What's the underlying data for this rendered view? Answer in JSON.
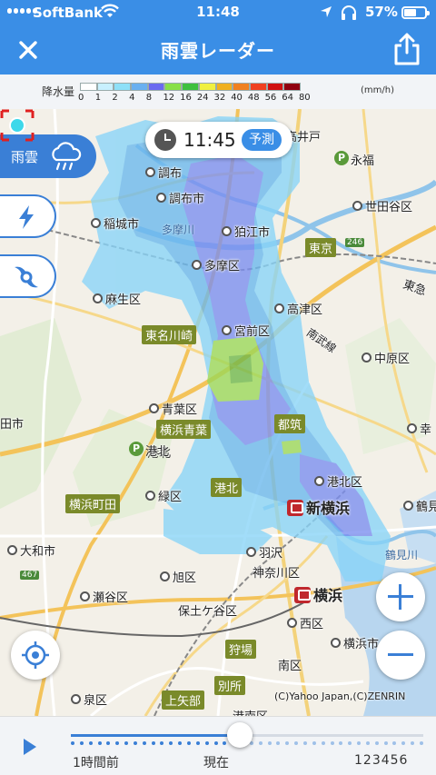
{
  "status_bar": {
    "carrier": "SoftBank",
    "time": "11:48",
    "battery": "57%",
    "battery_level": 0.57
  },
  "header": {
    "title": "雨雲レーダー",
    "close_icon": "close-icon",
    "share_icon": "share-icon"
  },
  "legend": {
    "label": "降水量",
    "unit": "(mm/h)",
    "values": [
      "0",
      "1",
      "2",
      "4",
      "8",
      "12",
      "16",
      "24",
      "32",
      "40",
      "48",
      "56",
      "64",
      "80"
    ],
    "colors": [
      "#ffffff",
      "#c8f0ff",
      "#8ee0f8",
      "#6ab0f0",
      "#6a6af0",
      "#88e048",
      "#3ec03e",
      "#f0f040",
      "#f0b020",
      "#f08020",
      "#f04020",
      "#d01010",
      "#900010"
    ]
  },
  "map": {
    "time_pill": {
      "time": "11:45",
      "badge": "予測"
    },
    "side_buttons": {
      "rain_label": "雨雲",
      "lightning_icon": "lightning-icon",
      "typhoon_icon": "typhoon-icon"
    },
    "places": [
      "調布",
      "調布市",
      "稲城市",
      "多摩川",
      "狛江市",
      "世田谷区",
      "多摩区",
      "麻生区",
      "高津区",
      "宮前区",
      "南武線",
      "中原区",
      "青葉区",
      "都筑",
      "港北",
      "港北区",
      "鶴見",
      "緑区",
      "横浜町田",
      "大和市",
      "羽沢",
      "神奈川区",
      "旭区",
      "瀬谷区",
      "保土ケ谷区",
      "西区",
      "狩場",
      "南区",
      "横浜市",
      "別所",
      "上矢部",
      "港南区",
      "泉区",
      "永福",
      "東京",
      "東急",
      "高井戸",
      "東名川崎",
      "横浜青葉",
      "新横浜",
      "横浜",
      "鶴見川",
      "鶴見",
      "田市",
      "幸",
      "246",
      "467"
    ],
    "copyright": "(C)Yahoo Japan,(C)ZENRIN"
  },
  "timeline": {
    "label_past": "1時間前",
    "label_now": "現在",
    "label_future": "123456",
    "position": 0.48
  }
}
